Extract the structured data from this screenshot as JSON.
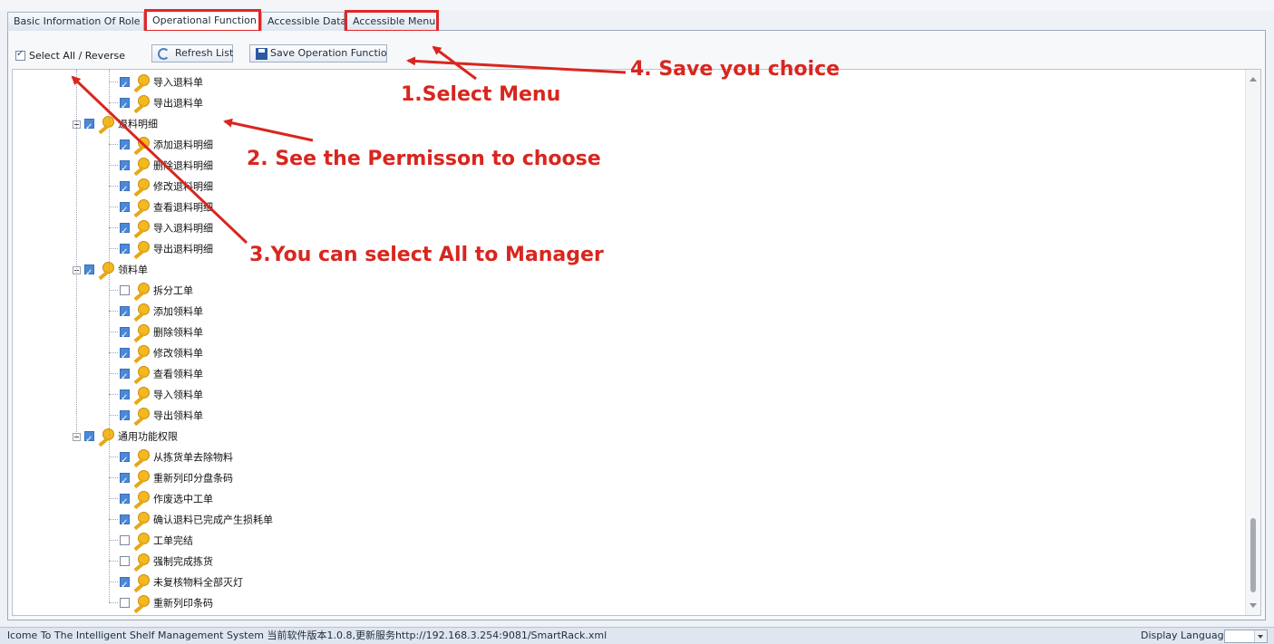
{
  "tabs": [
    {
      "label": "Basic Information Of Role",
      "active": false,
      "highlighted": false
    },
    {
      "label": "Operational Function",
      "active": true,
      "highlighted": true
    },
    {
      "label": "Accessible Data",
      "active": false,
      "highlighted": false
    },
    {
      "label": "Accessible Menu",
      "active": false,
      "highlighted": true
    }
  ],
  "toolbar": {
    "select_all_label": "Select All / Reverse",
    "select_all_checked": true,
    "refresh_label": "Refresh List",
    "save_label": "Save Operation Functior"
  },
  "tree": {
    "nodes": [
      {
        "label": "导入退料单",
        "checked": true,
        "level": 2
      },
      {
        "label": "导出退料单",
        "checked": true,
        "level": 2
      },
      {
        "label": "退料明细",
        "checked": true,
        "level": 1
      },
      {
        "label": "添加退料明细",
        "checked": true,
        "level": 2
      },
      {
        "label": "删除退料明细",
        "checked": true,
        "level": 2
      },
      {
        "label": "修改退料明细",
        "checked": true,
        "level": 2
      },
      {
        "label": "查看退料明细",
        "checked": true,
        "level": 2
      },
      {
        "label": "导入退料明细",
        "checked": true,
        "level": 2
      },
      {
        "label": "导出退料明细",
        "checked": true,
        "level": 2
      },
      {
        "label": "领料单",
        "checked": true,
        "level": 1
      },
      {
        "label": "拆分工单",
        "checked": false,
        "level": 2
      },
      {
        "label": "添加领料单",
        "checked": true,
        "level": 2
      },
      {
        "label": "删除领料单",
        "checked": true,
        "level": 2
      },
      {
        "label": "修改领料单",
        "checked": true,
        "level": 2
      },
      {
        "label": "查看领料单",
        "checked": true,
        "level": 2
      },
      {
        "label": "导入领料单",
        "checked": true,
        "level": 2
      },
      {
        "label": "导出领料单",
        "checked": true,
        "level": 2
      },
      {
        "label": "通用功能权限",
        "checked": true,
        "level": 1
      },
      {
        "label": "从拣货单去除物料",
        "checked": true,
        "level": 2
      },
      {
        "label": "重新列印分盘条码",
        "checked": true,
        "level": 2
      },
      {
        "label": "作废选中工单",
        "checked": true,
        "level": 2
      },
      {
        "label": "确认退料已完成产生损耗单",
        "checked": true,
        "level": 2
      },
      {
        "label": "工单完结",
        "checked": false,
        "level": 2
      },
      {
        "label": "强制完成拣货",
        "checked": false,
        "level": 2
      },
      {
        "label": "未复核物料全部灭灯",
        "checked": true,
        "level": 2
      },
      {
        "label": "重新列印条码",
        "checked": false,
        "level": 2
      }
    ]
  },
  "annotations": {
    "a1": "1.Select Menu",
    "a2": "2. See the Permisson to choose",
    "a3": "3.You can select All to Manager",
    "a4": "4. Save you choice"
  },
  "status": {
    "message": "lcome To The Intelligent Shelf Management System  当前软件版本1.0.8,更新服务http://192.168.3.254:9081/SmartRack.xml",
    "display_language_label": "Display Language",
    "display_language_value": ""
  },
  "colors": {
    "annotation": "#d8261f",
    "checkbox_checked": "#4b88d8",
    "key_icon": "#f4b820"
  }
}
